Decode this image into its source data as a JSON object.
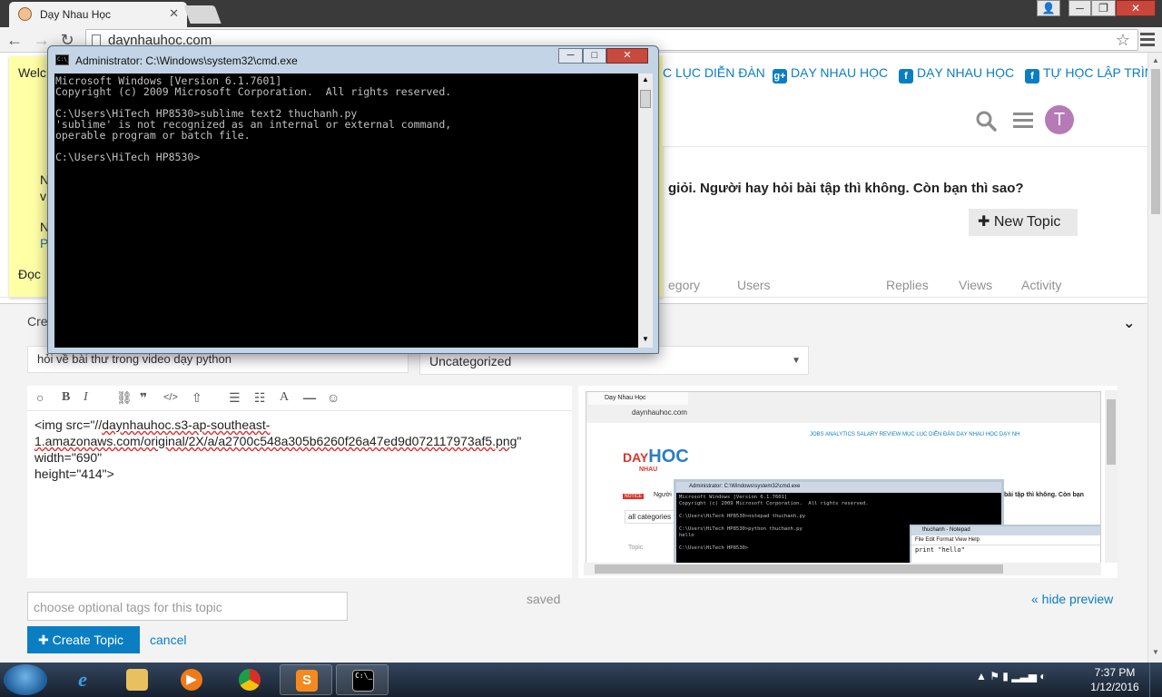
{
  "browser": {
    "tab_title": "Dạy Nhau Học",
    "tab_close": "✕",
    "url": "daynhauhoc.com",
    "back": "←",
    "forward": "→",
    "reload": "↻",
    "star": "☆",
    "win_min": "─",
    "win_max": "❐",
    "win_close": "✕"
  },
  "forum": {
    "notice": {
      "welcome": "Welc",
      "item1_a": "N",
      "item1_b": "v",
      "item2_a": "N",
      "item2_b": "P",
      "doc": "Đọc"
    },
    "top_links": [
      "C LỤC DIỄN ĐÀN",
      "DẠY NHAU HỌC",
      "DẠY NHAU HỌC",
      "TỰ HỌC LẬP TRÌNH"
    ],
    "top_link_icons": [
      "",
      "g+",
      "f",
      "f"
    ],
    "avatar_letter": "T",
    "banner": "giỏi. Người hay hỏi bài tập thì không. Còn bạn thì sao?",
    "new_topic": "New Topic",
    "columns": {
      "category": "egory",
      "users": "Users",
      "replies": "Replies",
      "views": "Views",
      "activity": "Activity"
    },
    "composer": {
      "create_label": "Cre",
      "toggle": "⌄",
      "title_value": "hỏi về bài thư trong video dạy python",
      "category": "Uncategorized",
      "category_arrow": "▼",
      "editor_text_1": "<img src=\"//",
      "editor_text_link": "daynhauhoc.s3-ap-southeast-",
      "editor_text_2": "1.amazonaws.com/original/2X/a/a2700c548a305b6260f26a47ed9d072117973af5.png",
      "editor_text_3": "\" width=\"690\"",
      "editor_text_4": "height=\"414\">",
      "tags_placeholder": "choose optional tags for this topic",
      "saved": "saved",
      "hide_preview": "« hide preview",
      "create_button": "Create Topic",
      "cancel": "cancel"
    },
    "toolbar_icons": [
      "💬",
      "B",
      "I",
      "🔗",
      "❝❝",
      "</>",
      "⇧",
      "☰",
      "☷",
      "A",
      "—",
      "☺"
    ],
    "preview": {
      "tab": "Dạy Nhau Học",
      "url": "daynhauhoc.com",
      "links": "JOBS ANALYTICS     SALARY REVIEW     MỤC LỤC DIỄN ĐÀN     DẠY NHAU HỌC     DẠY NH",
      "logo_day": "DAY",
      "logo_hoc": "HOC",
      "logo_nhau": "NHAU",
      "notice_tag": "NOTICE",
      "notice": "Người",
      "banner": "bài tập thì không. Còn bạn",
      "all_categories": "all categories",
      "topic": "Topic",
      "cmd_title": "Administrator: C:\\Windows\\system32\\cmd.exe",
      "cmd_text": "Microsoft Windows [Version 6.1.7601]\nCopyright (c) 2009 Microsoft Corporation.  All rights reserved.\n\nC:\\Users\\HiTech HP8530>notepad thuchanh.py\n\nC:\\Users\\HiTech HP8530>python thuchanh.py\nhello\n\nC:\\Users\\HiTech HP8530>",
      "notepad_title": "thuchanh - Notepad",
      "notepad_menu": "File  Edit  Format  View  Help",
      "notepad_text": "print \"hello\""
    }
  },
  "cmd": {
    "title": "Administrator: C:\\Windows\\system32\\cmd.exe",
    "icon_text": "C:\\_",
    "min": "─",
    "max": "□",
    "close": "✕",
    "output": "Microsoft Windows [Version 6.1.7601]\nCopyright (c) 2009 Microsoft Corporation.  All rights reserved.\n\nC:\\Users\\HiTech HP8530>sublime text2 thuchanh.py\n'sublime' is not recognized as an internal or external command,\noperable program or batch file.\n\nC:\\Users\\HiTech HP8530>"
  },
  "taskbar": {
    "apps": [
      "e",
      "📁",
      "▶",
      "◎",
      "S",
      "C:\\_"
    ],
    "tray": "▲  ⚑  ▮  ▂▃▅  ◐",
    "time": "7:37 PM",
    "date": "1/12/2016"
  },
  "colors": {
    "accent": "#0a7ec2",
    "notice_bg": "#ffffa6",
    "cmd_bg": "#000000",
    "cmd_text": "#c0c0c0"
  }
}
